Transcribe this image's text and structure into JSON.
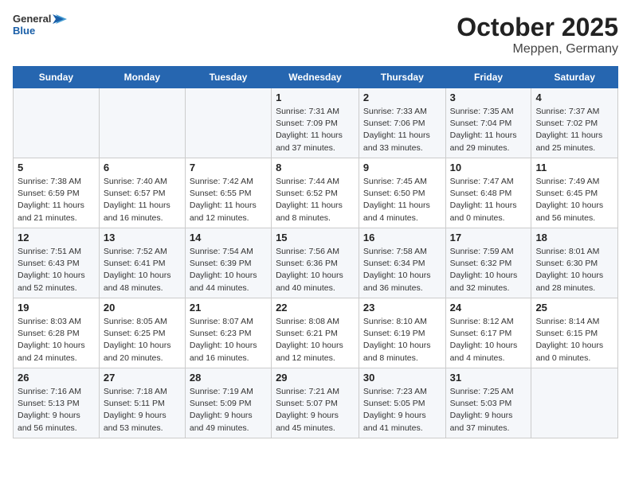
{
  "header": {
    "logo_general": "General",
    "logo_blue": "Blue",
    "month_title": "October 2025",
    "subtitle": "Meppen, Germany"
  },
  "weekdays": [
    "Sunday",
    "Monday",
    "Tuesday",
    "Wednesday",
    "Thursday",
    "Friday",
    "Saturday"
  ],
  "weeks": [
    [
      {
        "day": "",
        "sunrise": "",
        "sunset": "",
        "daylight": ""
      },
      {
        "day": "",
        "sunrise": "",
        "sunset": "",
        "daylight": ""
      },
      {
        "day": "",
        "sunrise": "",
        "sunset": "",
        "daylight": ""
      },
      {
        "day": "1",
        "sunrise": "Sunrise: 7:31 AM",
        "sunset": "Sunset: 7:09 PM",
        "daylight": "Daylight: 11 hours and 37 minutes."
      },
      {
        "day": "2",
        "sunrise": "Sunrise: 7:33 AM",
        "sunset": "Sunset: 7:06 PM",
        "daylight": "Daylight: 11 hours and 33 minutes."
      },
      {
        "day": "3",
        "sunrise": "Sunrise: 7:35 AM",
        "sunset": "Sunset: 7:04 PM",
        "daylight": "Daylight: 11 hours and 29 minutes."
      },
      {
        "day": "4",
        "sunrise": "Sunrise: 7:37 AM",
        "sunset": "Sunset: 7:02 PM",
        "daylight": "Daylight: 11 hours and 25 minutes."
      }
    ],
    [
      {
        "day": "5",
        "sunrise": "Sunrise: 7:38 AM",
        "sunset": "Sunset: 6:59 PM",
        "daylight": "Daylight: 11 hours and 21 minutes."
      },
      {
        "day": "6",
        "sunrise": "Sunrise: 7:40 AM",
        "sunset": "Sunset: 6:57 PM",
        "daylight": "Daylight: 11 hours and 16 minutes."
      },
      {
        "day": "7",
        "sunrise": "Sunrise: 7:42 AM",
        "sunset": "Sunset: 6:55 PM",
        "daylight": "Daylight: 11 hours and 12 minutes."
      },
      {
        "day": "8",
        "sunrise": "Sunrise: 7:44 AM",
        "sunset": "Sunset: 6:52 PM",
        "daylight": "Daylight: 11 hours and 8 minutes."
      },
      {
        "day": "9",
        "sunrise": "Sunrise: 7:45 AM",
        "sunset": "Sunset: 6:50 PM",
        "daylight": "Daylight: 11 hours and 4 minutes."
      },
      {
        "day": "10",
        "sunrise": "Sunrise: 7:47 AM",
        "sunset": "Sunset: 6:48 PM",
        "daylight": "Daylight: 11 hours and 0 minutes."
      },
      {
        "day": "11",
        "sunrise": "Sunrise: 7:49 AM",
        "sunset": "Sunset: 6:45 PM",
        "daylight": "Daylight: 10 hours and 56 minutes."
      }
    ],
    [
      {
        "day": "12",
        "sunrise": "Sunrise: 7:51 AM",
        "sunset": "Sunset: 6:43 PM",
        "daylight": "Daylight: 10 hours and 52 minutes."
      },
      {
        "day": "13",
        "sunrise": "Sunrise: 7:52 AM",
        "sunset": "Sunset: 6:41 PM",
        "daylight": "Daylight: 10 hours and 48 minutes."
      },
      {
        "day": "14",
        "sunrise": "Sunrise: 7:54 AM",
        "sunset": "Sunset: 6:39 PM",
        "daylight": "Daylight: 10 hours and 44 minutes."
      },
      {
        "day": "15",
        "sunrise": "Sunrise: 7:56 AM",
        "sunset": "Sunset: 6:36 PM",
        "daylight": "Daylight: 10 hours and 40 minutes."
      },
      {
        "day": "16",
        "sunrise": "Sunrise: 7:58 AM",
        "sunset": "Sunset: 6:34 PM",
        "daylight": "Daylight: 10 hours and 36 minutes."
      },
      {
        "day": "17",
        "sunrise": "Sunrise: 7:59 AM",
        "sunset": "Sunset: 6:32 PM",
        "daylight": "Daylight: 10 hours and 32 minutes."
      },
      {
        "day": "18",
        "sunrise": "Sunrise: 8:01 AM",
        "sunset": "Sunset: 6:30 PM",
        "daylight": "Daylight: 10 hours and 28 minutes."
      }
    ],
    [
      {
        "day": "19",
        "sunrise": "Sunrise: 8:03 AM",
        "sunset": "Sunset: 6:28 PM",
        "daylight": "Daylight: 10 hours and 24 minutes."
      },
      {
        "day": "20",
        "sunrise": "Sunrise: 8:05 AM",
        "sunset": "Sunset: 6:25 PM",
        "daylight": "Daylight: 10 hours and 20 minutes."
      },
      {
        "day": "21",
        "sunrise": "Sunrise: 8:07 AM",
        "sunset": "Sunset: 6:23 PM",
        "daylight": "Daylight: 10 hours and 16 minutes."
      },
      {
        "day": "22",
        "sunrise": "Sunrise: 8:08 AM",
        "sunset": "Sunset: 6:21 PM",
        "daylight": "Daylight: 10 hours and 12 minutes."
      },
      {
        "day": "23",
        "sunrise": "Sunrise: 8:10 AM",
        "sunset": "Sunset: 6:19 PM",
        "daylight": "Daylight: 10 hours and 8 minutes."
      },
      {
        "day": "24",
        "sunrise": "Sunrise: 8:12 AM",
        "sunset": "Sunset: 6:17 PM",
        "daylight": "Daylight: 10 hours and 4 minutes."
      },
      {
        "day": "25",
        "sunrise": "Sunrise: 8:14 AM",
        "sunset": "Sunset: 6:15 PM",
        "daylight": "Daylight: 10 hours and 0 minutes."
      }
    ],
    [
      {
        "day": "26",
        "sunrise": "Sunrise: 7:16 AM",
        "sunset": "Sunset: 5:13 PM",
        "daylight": "Daylight: 9 hours and 56 minutes."
      },
      {
        "day": "27",
        "sunrise": "Sunrise: 7:18 AM",
        "sunset": "Sunset: 5:11 PM",
        "daylight": "Daylight: 9 hours and 53 minutes."
      },
      {
        "day": "28",
        "sunrise": "Sunrise: 7:19 AM",
        "sunset": "Sunset: 5:09 PM",
        "daylight": "Daylight: 9 hours and 49 minutes."
      },
      {
        "day": "29",
        "sunrise": "Sunrise: 7:21 AM",
        "sunset": "Sunset: 5:07 PM",
        "daylight": "Daylight: 9 hours and 45 minutes."
      },
      {
        "day": "30",
        "sunrise": "Sunrise: 7:23 AM",
        "sunset": "Sunset: 5:05 PM",
        "daylight": "Daylight: 9 hours and 41 minutes."
      },
      {
        "day": "31",
        "sunrise": "Sunrise: 7:25 AM",
        "sunset": "Sunset: 5:03 PM",
        "daylight": "Daylight: 9 hours and 37 minutes."
      },
      {
        "day": "",
        "sunrise": "",
        "sunset": "",
        "daylight": ""
      }
    ]
  ]
}
